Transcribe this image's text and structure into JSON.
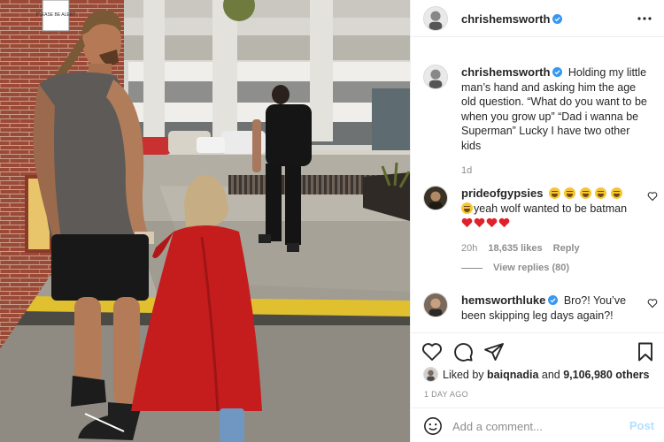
{
  "post": {
    "author": "chrishemsworth",
    "more_icon": "more-horizontal-icon"
  },
  "photo": {
    "sign_text": "PLEASE BE ALERT"
  },
  "caption": {
    "username": "chrishemsworth",
    "text": "Holding my little man’s hand and asking him the age old question. “What do you want to be when you grow up” “Dad i wanna be Superman” Lucky I have two other kids",
    "time": "1d"
  },
  "comments": [
    {
      "username": "prideofgypsies",
      "text": "yeah wolf wanted to be batman",
      "time": "20h",
      "likes": "18,635 likes",
      "reply_label": "Reply",
      "view_replies": "View replies (80)"
    },
    {
      "username": "hemsworthluke",
      "text": "Bro?! You’ve been skipping leg days again?!"
    }
  ],
  "actions": {
    "liked_by_prefix": "Liked by",
    "liked_by_user": "baiqnadia",
    "and_label": "and",
    "others_count": "9,106,980 others",
    "date": "1 DAY AGO"
  },
  "comment_box": {
    "placeholder": "Add a comment...",
    "post_label": "Post"
  },
  "colors": {
    "accent_blue": "#0095f6",
    "post_disabled": "#b2dffc",
    "like_red": "#ed4956",
    "verified_blue": "#3897f0"
  }
}
